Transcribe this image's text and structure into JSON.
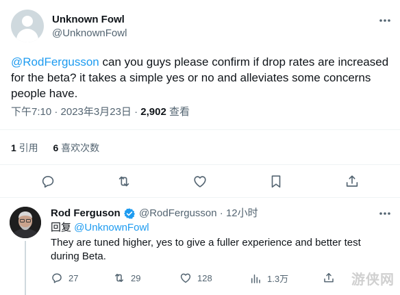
{
  "main_tweet": {
    "author": {
      "display_name": "Unknown Fowl",
      "handle": "@UnknownFowl"
    },
    "text_mention": "@RodFergusson",
    "text_body": " can you guys please confirm if drop rates are increased for the beta? it takes a simple yes or no and alleviates some concerns people have.",
    "timestamp": "下午7:10 · 2023年3月23日 · ",
    "views_count": "2,902",
    "views_label": " 查看",
    "stats": {
      "quotes_count": "1",
      "quotes_label": " 引用",
      "likes_count": "6",
      "likes_label": " 喜欢次数"
    },
    "actions": {
      "reply_icon": "reply-icon",
      "retweet_icon": "retweet-icon",
      "like_icon": "heart-icon",
      "bookmark_icon": "bookmark-icon",
      "share_icon": "share-icon"
    }
  },
  "reply_tweet": {
    "author": {
      "display_name": "Rod Ferguson",
      "handle": "@RodFergusson",
      "time_ago": "12小时",
      "separator": " · "
    },
    "replying_to_label": "回复 ",
    "replying_to_handle": "@UnknownFowl",
    "text": "They are tuned higher, yes to give a fuller experience and better test during Beta.",
    "actions": {
      "replies": "27",
      "retweets": "29",
      "likes": "128",
      "views": "1.3万"
    }
  },
  "watermark": "游侠网",
  "colors": {
    "accent": "#1d9bf0",
    "secondary_text": "#536471",
    "primary_text": "#0f1419",
    "divider": "#eff3f4"
  }
}
